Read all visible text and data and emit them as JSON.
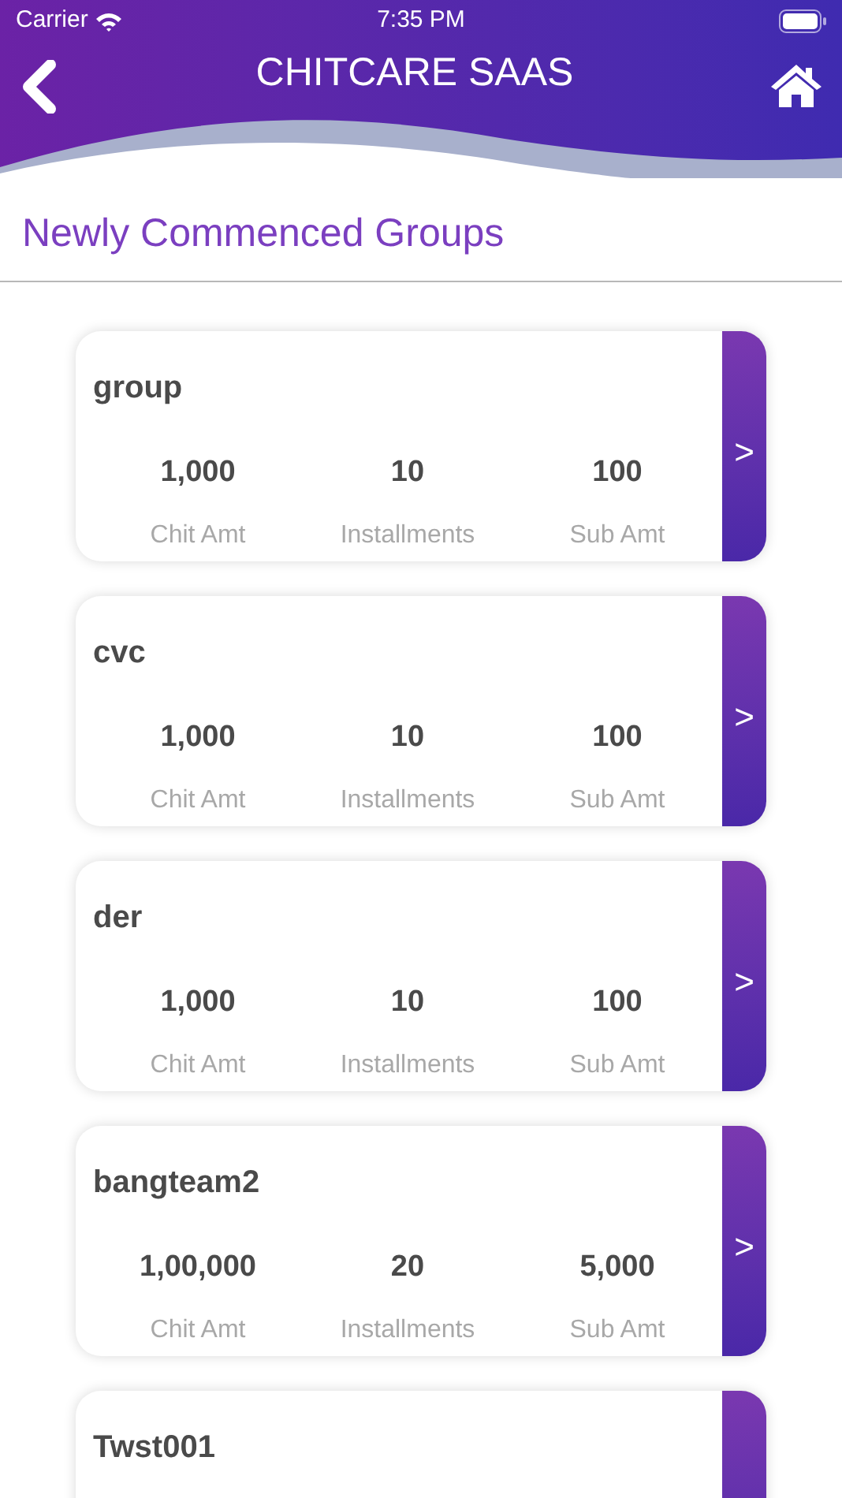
{
  "status_bar": {
    "carrier": "Carrier",
    "time": "7:35 PM"
  },
  "header": {
    "title": "CHITCARE SAAS"
  },
  "section": {
    "title": "Newly Commenced Groups"
  },
  "groups": [
    {
      "name": "group",
      "arrow": ">",
      "stats": [
        {
          "value": "1,000",
          "label": "Chit Amt"
        },
        {
          "value": "10",
          "label": "Installments"
        },
        {
          "value": "100",
          "label": "Sub Amt"
        }
      ]
    },
    {
      "name": "cvc",
      "arrow": ">",
      "stats": [
        {
          "value": "1,000",
          "label": "Chit Amt"
        },
        {
          "value": "10",
          "label": "Installments"
        },
        {
          "value": "100",
          "label": "Sub Amt"
        }
      ]
    },
    {
      "name": "der",
      "arrow": ">",
      "stats": [
        {
          "value": "1,000",
          "label": "Chit Amt"
        },
        {
          "value": "10",
          "label": "Installments"
        },
        {
          "value": "100",
          "label": "Sub Amt"
        }
      ]
    },
    {
      "name": "bangteam2",
      "arrow": ">",
      "stats": [
        {
          "value": "1,00,000",
          "label": "Chit Amt"
        },
        {
          "value": "20",
          "label": "Installments"
        },
        {
          "value": "5,000",
          "label": "Sub Amt"
        }
      ]
    },
    {
      "name": "Twst001"
    }
  ]
}
